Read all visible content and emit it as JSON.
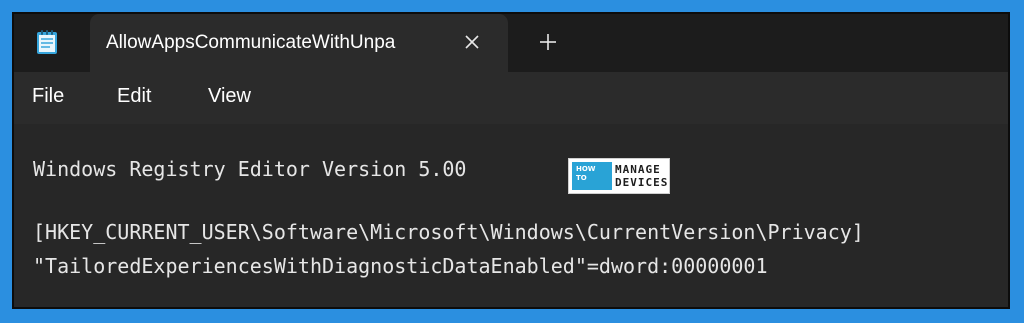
{
  "window": {
    "tab_title": "AllowAppsCommunicateWithUnpa",
    "icons": {
      "app": "notepad-icon",
      "close": "close-icon",
      "new_tab": "plus-icon"
    }
  },
  "menu": {
    "items": [
      "File",
      "Edit",
      "View"
    ]
  },
  "editor": {
    "lines": [
      "Windows Registry Editor Version 5.00",
      "[HKEY_CURRENT_USER\\Software\\Microsoft\\Windows\\CurrentVersion\\Privacy]",
      "\"TailoredExperiencesWithDiagnosticDataEnabled\"=dword:00000001"
    ]
  },
  "watermark": {
    "text_lines": [
      "HOW",
      "TO",
      "MANAGE",
      "DEVICES"
    ]
  },
  "colors": {
    "background": "#2b8fe0",
    "editor_bg": "#272727",
    "text": "#e6e6e6",
    "logo_accent": "#29a3d6"
  }
}
